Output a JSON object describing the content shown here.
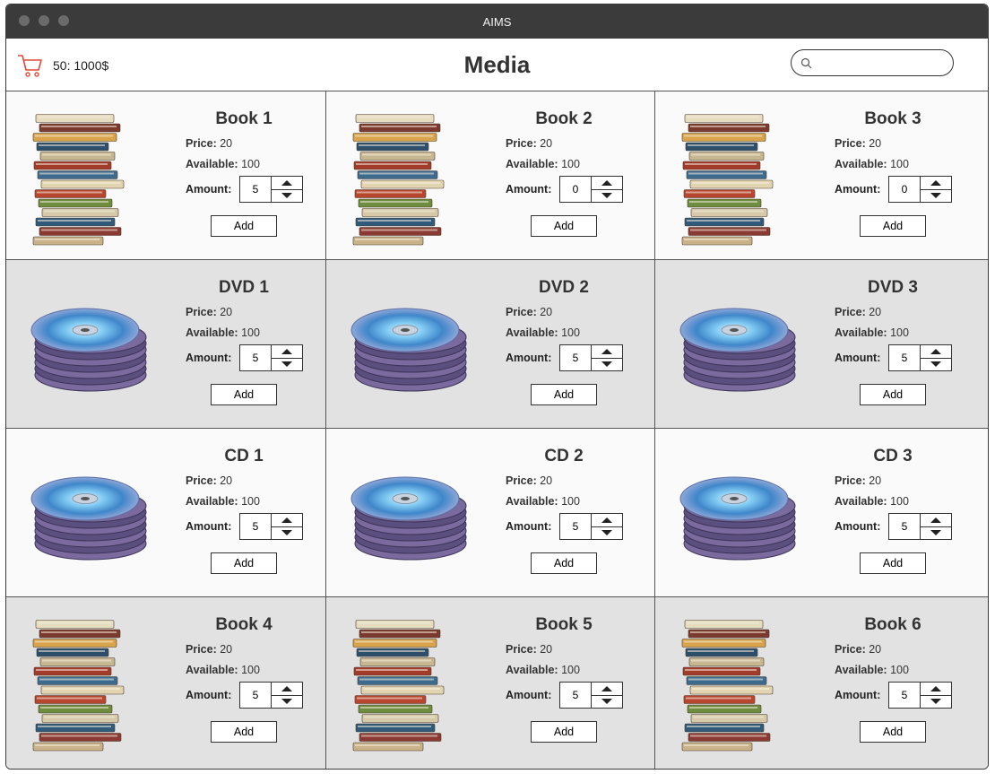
{
  "window": {
    "title": "AIMS"
  },
  "header": {
    "cart_summary": "50: 1000$",
    "title": "Media",
    "search_placeholder": "",
    "accent": "#e04a3a"
  },
  "labels": {
    "price": "Price:",
    "available": "Available:",
    "amount": "Amount:",
    "add": "Add"
  },
  "items": [
    {
      "name": "Book 1",
      "type": "book",
      "price": "20",
      "available": "100",
      "amount": "5"
    },
    {
      "name": "Book 2",
      "type": "book",
      "price": "20",
      "available": "100",
      "amount": "0"
    },
    {
      "name": "Book 3",
      "type": "book",
      "price": "20",
      "available": "100",
      "amount": "0"
    },
    {
      "name": "DVD 1",
      "type": "disc",
      "price": "20",
      "available": "100",
      "amount": "5"
    },
    {
      "name": "DVD 2",
      "type": "disc",
      "price": "20",
      "available": "100",
      "amount": "5"
    },
    {
      "name": "DVD 3",
      "type": "disc",
      "price": "20",
      "available": "100",
      "amount": "5"
    },
    {
      "name": "CD 1",
      "type": "disc",
      "price": "20",
      "available": "100",
      "amount": "5"
    },
    {
      "name": "CD 2",
      "type": "disc",
      "price": "20",
      "available": "100",
      "amount": "5"
    },
    {
      "name": "CD 3",
      "type": "disc",
      "price": "20",
      "available": "100",
      "amount": "5"
    },
    {
      "name": "Book 4",
      "type": "book",
      "price": "20",
      "available": "100",
      "amount": "5"
    },
    {
      "name": "Book 5",
      "type": "book",
      "price": "20",
      "available": "100",
      "amount": "5"
    },
    {
      "name": "Book 6",
      "type": "book",
      "price": "20",
      "available": "100",
      "amount": "5"
    }
  ]
}
